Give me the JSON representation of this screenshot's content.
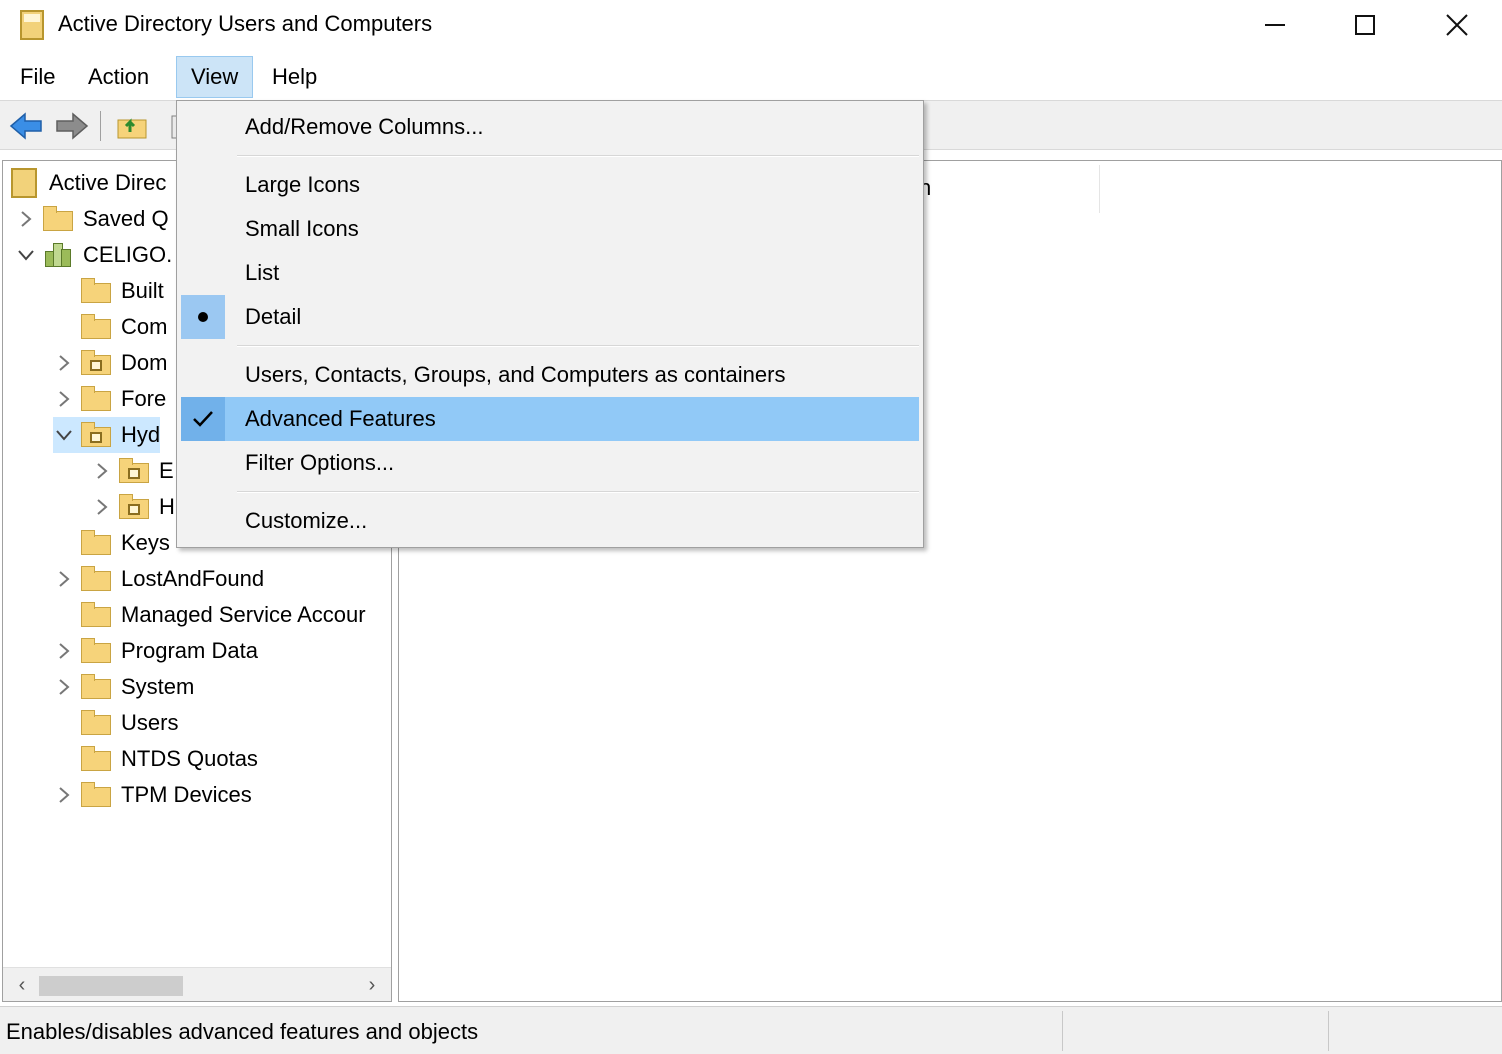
{
  "window": {
    "title": "Active Directory Users and Computers"
  },
  "menubar": {
    "file": "File",
    "action": "Action",
    "view": "View",
    "help": "Help"
  },
  "toolbar": {
    "icons": [
      "back-arrow-icon",
      "forward-arrow-icon",
      "up-folder-icon",
      "show-tree-icon"
    ]
  },
  "tree": {
    "items": [
      {
        "label": "Active Direc",
        "expander": "",
        "icon": "ad-root-icon"
      },
      {
        "label": "Saved Q",
        "expander": "›",
        "icon": "folder-icon"
      },
      {
        "label": "CELIGO.",
        "expander": "⌄",
        "icon": "domain-icon"
      },
      {
        "label": "Built",
        "expander": "",
        "icon": "folder-icon"
      },
      {
        "label": "Com",
        "expander": "",
        "icon": "folder-icon"
      },
      {
        "label": "Dom",
        "expander": "›",
        "icon": "ou-folder-icon"
      },
      {
        "label": "Fore",
        "expander": "›",
        "icon": "folder-icon"
      },
      {
        "label": "Hyd",
        "expander": "⌄",
        "icon": "ou-folder-icon"
      },
      {
        "label": "E",
        "expander": "›",
        "icon": "ou-folder-icon"
      },
      {
        "label": "H",
        "expander": "›",
        "icon": "ou-folder-icon"
      },
      {
        "label": "Keys",
        "expander": "",
        "icon": "folder-icon"
      },
      {
        "label": "LostAndFound",
        "expander": "›",
        "icon": "folder-icon"
      },
      {
        "label": "Managed Service Accour",
        "expander": "",
        "icon": "folder-icon"
      },
      {
        "label": "Program Data",
        "expander": "›",
        "icon": "folder-icon"
      },
      {
        "label": "System",
        "expander": "›",
        "icon": "folder-icon"
      },
      {
        "label": "Users",
        "expander": "",
        "icon": "folder-icon"
      },
      {
        "label": "NTDS Quotas",
        "expander": "",
        "icon": "folder-icon"
      },
      {
        "label": "TPM Devices",
        "expander": "›",
        "icon": "folder-icon"
      }
    ]
  },
  "detail": {
    "column_fragment": "n"
  },
  "view_menu": {
    "items": [
      {
        "label": "Add/Remove Columns...",
        "mark": ""
      },
      {
        "label": "Large Icons",
        "mark": ""
      },
      {
        "label": "Small Icons",
        "mark": ""
      },
      {
        "label": "List",
        "mark": ""
      },
      {
        "label": "Detail",
        "mark": "bullet"
      },
      {
        "label": "Users, Contacts, Groups, and Computers as containers",
        "mark": ""
      },
      {
        "label": "Advanced Features",
        "mark": "check"
      },
      {
        "label": "Filter Options...",
        "mark": ""
      },
      {
        "label": "Customize...",
        "mark": ""
      }
    ]
  },
  "statusbar": {
    "text": "Enables/disables advanced features and objects"
  },
  "colors": {
    "highlight": "#91c9f7",
    "menu_bg": "#f2f2f2",
    "folder": "#f6d37a"
  }
}
